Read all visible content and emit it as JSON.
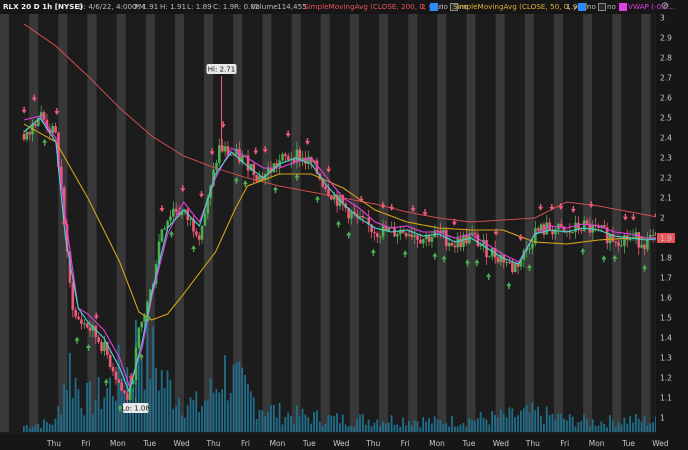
{
  "header": {
    "symbol": "RLX 20 D 1h [NYSE]",
    "date": "D: 4/6/22, 4:00 PM",
    "open": "O: 1.91",
    "high": "H: 1.91",
    "low": "L: 1.89",
    "close": "C: 1.9",
    "change": "R: 0.02",
    "volume_label": "Volume",
    "volume_value": "114,455",
    "sma200_label": "SimpleMovingAvg (CLOSE, 200, 0, yes)",
    "sma200_value": "2",
    "sma200_opt1": "no",
    "sma200_opt2": "no",
    "sma50_label": "SimpleMovingAvg (CLOSE, 50, 0, yes)",
    "sma50_value": "1.91",
    "sma50_opt1": "no",
    "sma50_opt2": "no",
    "vwap_label": "VWAP (-0.0..."
  },
  "icons": {
    "settings": "gear-icon"
  },
  "colors": {
    "background": "#1c1c1c",
    "band": "#383838",
    "candle_up": "#4caf50",
    "candle_down": "#ef5a78",
    "sma200": "#e05050",
    "sma50": "#d4a017",
    "vwap": "#e040e0",
    "fast_line": "#4fd1d1",
    "volume": "#1f6e8c",
    "price_tag": "#e8545a"
  },
  "chart_data": {
    "type": "candlestick",
    "y_ticks": [
      "1",
      "1.1",
      "1.2",
      "1.3",
      "1.4",
      "1.5",
      "1.6",
      "1.7",
      "1.8",
      "1.9",
      "2",
      "2.1",
      "2.2",
      "2.3",
      "2.4",
      "2.5",
      "2.6",
      "2.7",
      "2.8",
      "2.9",
      "3"
    ],
    "ylim": [
      0.93,
      3.02
    ],
    "x_ticks": [
      "Thu",
      "Fri",
      "Mon",
      "Tue",
      "Wed",
      "Thu",
      "Fri",
      "Mon",
      "Tue",
      "Wed",
      "Thu",
      "Fri",
      "Mon",
      "Tue",
      "Wed",
      "Thu",
      "Fri",
      "Mon",
      "Tue",
      "Wed"
    ],
    "last_price": "1.9",
    "annotations": [
      {
        "label": "Hi: 2.71",
        "value": 2.71,
        "day_index": 6
      },
      {
        "label": "Lo: 1.08",
        "value": 1.08,
        "day_index": 3
      }
    ],
    "series": [
      {
        "name": "SimpleMovingAvg (CLOSE, 200, 0, yes)",
        "role": "sma200",
        "points": [
          [
            0,
            2.97
          ],
          [
            1,
            2.86
          ],
          [
            2,
            2.71
          ],
          [
            3,
            2.55
          ],
          [
            4,
            2.41
          ],
          [
            5,
            2.31
          ],
          [
            6,
            2.25
          ],
          [
            7,
            2.2
          ],
          [
            8,
            2.16
          ],
          [
            9,
            2.13
          ],
          [
            10,
            2.1
          ],
          [
            11,
            2.07
          ],
          [
            12,
            2.03
          ],
          [
            13,
            2.0
          ],
          [
            14,
            1.98
          ],
          [
            15,
            1.99
          ],
          [
            16,
            2.0
          ],
          [
            17,
            2.08
          ],
          [
            18,
            2.06
          ],
          [
            19,
            2.03
          ],
          [
            20,
            2.0
          ]
        ]
      },
      {
        "name": "SimpleMovingAvg (CLOSE, 50, 0, yes)",
        "role": "sma50",
        "points": [
          [
            0,
            2.47
          ],
          [
            1,
            2.38
          ],
          [
            2,
            2.1
          ],
          [
            3,
            1.78
          ],
          [
            3.6,
            1.53
          ],
          [
            4,
            1.49
          ],
          [
            4.5,
            1.52
          ],
          [
            5,
            1.62
          ],
          [
            6,
            1.83
          ],
          [
            6.6,
            2.04
          ],
          [
            7,
            2.16
          ],
          [
            8,
            2.22
          ],
          [
            9,
            2.22
          ],
          [
            10,
            2.15
          ],
          [
            11,
            2.04
          ],
          [
            12,
            1.98
          ],
          [
            13,
            1.95
          ],
          [
            14,
            1.94
          ],
          [
            15,
            1.94
          ],
          [
            16,
            1.88
          ],
          [
            17,
            1.87
          ],
          [
            18,
            1.89
          ],
          [
            19,
            1.9
          ],
          [
            20,
            1.9
          ]
        ]
      },
      {
        "name": "VWAP (-0.0...",
        "role": "vwap",
        "points": [
          [
            0,
            2.49
          ],
          [
            0.5,
            2.51
          ],
          [
            1,
            2.4
          ],
          [
            1.3,
            2.0
          ],
          [
            1.7,
            1.55
          ],
          [
            2,
            1.52
          ],
          [
            2.5,
            1.44
          ],
          [
            3,
            1.3
          ],
          [
            3.3,
            1.16
          ],
          [
            3.7,
            1.35
          ],
          [
            4,
            1.6
          ],
          [
            4.5,
            1.92
          ],
          [
            5,
            2.08
          ],
          [
            5.5,
            1.98
          ],
          [
            6,
            2.2
          ],
          [
            6.5,
            2.35
          ],
          [
            7,
            2.3
          ],
          [
            7.5,
            2.25
          ],
          [
            8,
            2.25
          ],
          [
            8.5,
            2.28
          ],
          [
            9,
            2.3
          ],
          [
            9.5,
            2.2
          ],
          [
            10,
            2.1
          ],
          [
            10.5,
            2.05
          ],
          [
            11,
            1.98
          ],
          [
            11.5,
            1.95
          ],
          [
            12,
            1.96
          ],
          [
            12.5,
            1.93
          ],
          [
            13,
            1.93
          ],
          [
            13.5,
            1.9
          ],
          [
            14,
            1.92
          ],
          [
            14.5,
            1.87
          ],
          [
            15,
            1.82
          ],
          [
            15.5,
            1.78
          ],
          [
            16,
            1.92
          ],
          [
            16.5,
            1.96
          ],
          [
            17,
            1.95
          ],
          [
            17.5,
            1.97
          ],
          [
            18,
            1.96
          ],
          [
            18.5,
            1.93
          ],
          [
            19,
            1.92
          ],
          [
            19.5,
            1.9
          ],
          [
            20,
            1.9
          ]
        ]
      },
      {
        "name": "",
        "role": "fast",
        "points": [
          [
            0,
            2.43
          ],
          [
            0.5,
            2.5
          ],
          [
            1,
            2.38
          ],
          [
            1.3,
            1.9
          ],
          [
            1.7,
            1.55
          ],
          [
            2,
            1.48
          ],
          [
            2.5,
            1.4
          ],
          [
            3,
            1.25
          ],
          [
            3.3,
            1.13
          ],
          [
            3.7,
            1.38
          ],
          [
            4,
            1.62
          ],
          [
            4.5,
            1.95
          ],
          [
            5,
            2.04
          ],
          [
            5.5,
            1.96
          ],
          [
            6,
            2.22
          ],
          [
            6.5,
            2.33
          ],
          [
            7,
            2.26
          ],
          [
            7.5,
            2.2
          ],
          [
            8,
            2.27
          ],
          [
            8.5,
            2.3
          ],
          [
            9,
            2.27
          ],
          [
            9.5,
            2.16
          ],
          [
            10,
            2.07
          ],
          [
            10.5,
            2.0
          ],
          [
            11,
            1.95
          ],
          [
            11.5,
            1.93
          ],
          [
            12,
            1.94
          ],
          [
            12.5,
            1.91
          ],
          [
            13,
            1.92
          ],
          [
            13.5,
            1.88
          ],
          [
            14,
            1.9
          ],
          [
            14.5,
            1.85
          ],
          [
            15,
            1.8
          ],
          [
            15.5,
            1.77
          ],
          [
            16,
            1.92
          ],
          [
            16.5,
            1.94
          ],
          [
            17,
            1.93
          ],
          [
            17.5,
            1.95
          ],
          [
            18,
            1.94
          ],
          [
            18.5,
            1.91
          ],
          [
            19,
            1.9
          ],
          [
            19.5,
            1.89
          ],
          [
            20,
            1.9
          ]
        ]
      }
    ],
    "candle_anchors": [
      [
        0,
        2.42
      ],
      [
        0.5,
        2.52
      ],
      [
        1,
        2.4
      ],
      [
        1.2,
        2.1
      ],
      [
        1.4,
        1.7
      ],
      [
        1.6,
        1.5
      ],
      [
        2,
        1.46
      ],
      [
        2.4,
        1.38
      ],
      [
        2.8,
        1.25
      ],
      [
        3.1,
        1.12
      ],
      [
        3.3,
        1.1
      ],
      [
        3.6,
        1.42
      ],
      [
        4,
        1.65
      ],
      [
        4.3,
        1.95
      ],
      [
        4.7,
        2.05
      ],
      [
        5,
        2.02
      ],
      [
        5.5,
        1.93
      ],
      [
        5.8,
        2.1
      ],
      [
        6.1,
        2.35
      ],
      [
        6.5,
        2.32
      ],
      [
        7,
        2.28
      ],
      [
        7.4,
        2.2
      ],
      [
        8,
        2.28
      ],
      [
        8.5,
        2.32
      ],
      [
        9,
        2.27
      ],
      [
        9.5,
        2.15
      ],
      [
        10,
        2.06
      ],
      [
        10.5,
        1.98
      ],
      [
        11,
        1.94
      ],
      [
        11.5,
        1.93
      ],
      [
        12,
        1.94
      ],
      [
        12.5,
        1.9
      ],
      [
        13,
        1.92
      ],
      [
        13.5,
        1.87
      ],
      [
        14,
        1.91
      ],
      [
        14.5,
        1.84
      ],
      [
        15,
        1.8
      ],
      [
        15.3,
        1.75
      ],
      [
        15.6,
        1.8
      ],
      [
        16,
        1.93
      ],
      [
        16.5,
        1.95
      ],
      [
        17,
        1.92
      ],
      [
        17.5,
        1.96
      ],
      [
        18,
        1.93
      ],
      [
        18.5,
        1.9
      ],
      [
        19,
        1.9
      ],
      [
        19.5,
        1.88
      ],
      [
        20,
        1.9
      ]
    ],
    "volume_anchors": [
      [
        0,
        0.05
      ],
      [
        1,
        0.08
      ],
      [
        1.4,
        0.55
      ],
      [
        1.7,
        0.35
      ],
      [
        2,
        0.25
      ],
      [
        2.5,
        0.3
      ],
      [
        3,
        0.45
      ],
      [
        3.3,
        0.5
      ],
      [
        3.6,
        0.75
      ],
      [
        4,
        0.6
      ],
      [
        4.4,
        0.4
      ],
      [
        5,
        0.25
      ],
      [
        5.5,
        0.2
      ],
      [
        6,
        0.35
      ],
      [
        6.2,
        0.5
      ],
      [
        7,
        0.3
      ],
      [
        7.5,
        0.2
      ],
      [
        8,
        0.15
      ],
      [
        9,
        0.12
      ],
      [
        10,
        0.1
      ],
      [
        11,
        0.1
      ],
      [
        12,
        0.1
      ],
      [
        13,
        0.08
      ],
      [
        14,
        0.1
      ],
      [
        15,
        0.12
      ],
      [
        16,
        0.15
      ],
      [
        17,
        0.1
      ],
      [
        18,
        0.08
      ],
      [
        19,
        0.1
      ],
      [
        20,
        0.08
      ]
    ]
  }
}
